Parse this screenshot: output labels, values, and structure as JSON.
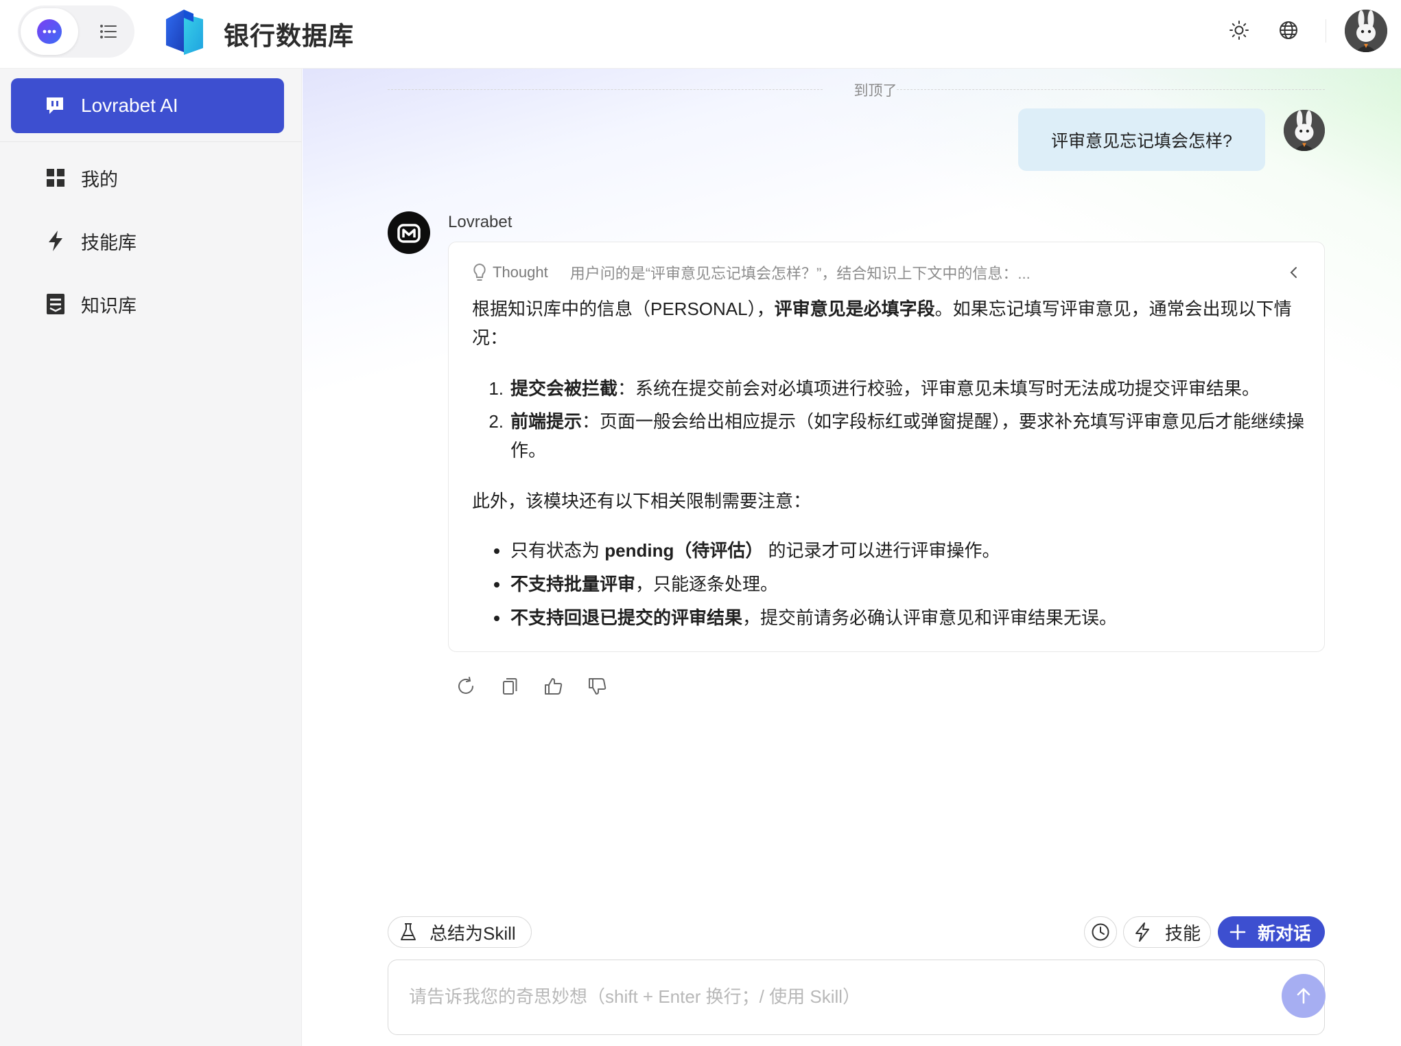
{
  "header": {
    "app_title": "银行数据库",
    "icons": {
      "mode_chat": "chat-bubble-icon",
      "mode_list": "list-icon",
      "theme": "sun-icon",
      "language": "globe-icon",
      "avatar": "rabbit-avatar"
    }
  },
  "sidebar": {
    "active_item": {
      "label": "Lovrabet AI",
      "icon": "ai-chat-icon"
    },
    "items": [
      {
        "label": "我的",
        "icon": "grid-icon"
      },
      {
        "label": "技能库",
        "icon": "lightning-icon"
      },
      {
        "label": "知识库",
        "icon": "document-icon"
      }
    ]
  },
  "chat": {
    "top_indicator": "到顶了",
    "user_message": "评审意见忘记填会怎样?",
    "bot_name": "Lovrabet",
    "thought": {
      "label": "Thought",
      "summary": "用户问的是“评审意见忘记填会怎样？”，结合知识上下文中的信息：..."
    },
    "answer": {
      "intro_prefix": "根据知识库中的信息（PERSONAL），",
      "intro_bold": "评审意见是必填字段",
      "intro_suffix": "。如果忘记填写评审意见，通常会出现以下情况：",
      "numbered": [
        {
          "num": "1.",
          "bold": "提交会被拦截",
          "text": "：系统在提交前会对必填项进行校验，评审意见未填写时无法成功提交评审结果。"
        },
        {
          "num": "2.",
          "bold": "前端提示",
          "text": "：页面一般会给出相应提示（如字段标红或弹窗提醒），要求补充填写评审意见后才能继续操作。"
        }
      ],
      "middle": "此外，该模块还有以下相关限制需要注意：",
      "bullets": [
        {
          "prefix": "只有状态为 ",
          "bold": "pending（待评估）",
          "text": " 的记录才可以进行评审操作。"
        },
        {
          "prefix": "",
          "bold": "不支持批量评审",
          "text": "，只能逐条处理。"
        },
        {
          "prefix": "",
          "bold": "不支持回退已提交的评审结果",
          "text": "，提交前请务必确认评审意见和评审结果无误。"
        }
      ]
    },
    "message_actions": [
      "refresh-icon",
      "copy-icon",
      "thumbs-up-icon",
      "thumbs-down-icon"
    ]
  },
  "composer": {
    "summarize_skill_label": "总结为Skill",
    "abilities_label": "技能",
    "new_chat_label": "新对话",
    "placeholder": "请告诉我您的奇思妙想（shift + Enter 换行；/ 使用 Skill）"
  },
  "colors": {
    "accent": "#3d4fd0",
    "user_bubble": "#ddeef8",
    "send_button": "#a6aef2",
    "sidebar_bg": "#f5f5f6"
  }
}
